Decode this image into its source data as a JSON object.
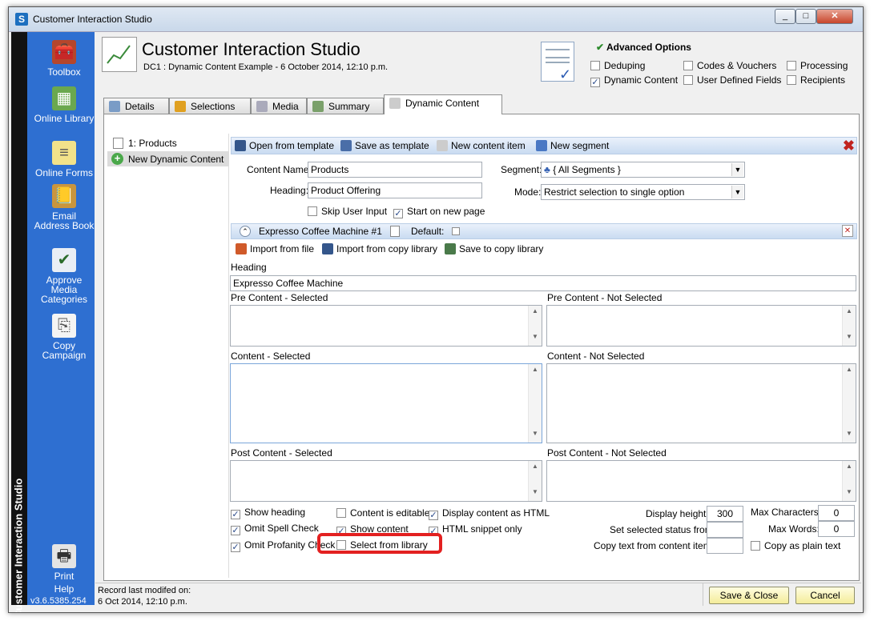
{
  "window": {
    "title": "Customer Interaction Studio",
    "app_icon": "S"
  },
  "sidebar": {
    "vertical_label": "Customer Interaction Studio",
    "items": [
      {
        "label": "Toolbox",
        "icon": "toolbox-icon"
      },
      {
        "label": "Online Library",
        "icon": "image-icon"
      },
      {
        "label": "Online Forms",
        "icon": "form-icon"
      },
      {
        "label": "Email Address Book",
        "icon": "address-book-icon"
      },
      {
        "label": "Approve Media Categories",
        "icon": "approve-media-icon"
      },
      {
        "label": "Copy Campaign",
        "icon": "copy-icon"
      }
    ],
    "print_label": "Print",
    "help_label": "Help",
    "version": "v3.6.5385.254"
  },
  "header": {
    "title": "Customer Interaction Studio",
    "subtitle": "DC1 : Dynamic Content Example - 6 October 2014, 12:10 p.m."
  },
  "advanced_options": {
    "title": "Advanced Options",
    "options": [
      {
        "label": "Deduping",
        "checked": false
      },
      {
        "label": "Codes & Vouchers",
        "checked": false
      },
      {
        "label": "Processing",
        "checked": false
      },
      {
        "label": "Dynamic Content",
        "checked": true
      },
      {
        "label": "User Defined Fields",
        "checked": false
      },
      {
        "label": "Recipients",
        "checked": false
      }
    ]
  },
  "tabs": [
    {
      "label": "Details"
    },
    {
      "label": "Selections"
    },
    {
      "label": "Media"
    },
    {
      "label": "Summary"
    },
    {
      "label": "Dynamic Content"
    }
  ],
  "tree": {
    "item1": "1: Products",
    "item2": "New Dynamic Content"
  },
  "toolbar": {
    "open_template": "Open from template",
    "save_template": "Save as template",
    "new_content_item": "New content item",
    "new_segment": "New segment"
  },
  "form": {
    "content_name_label": "Content Name:",
    "content_name_value": "Products",
    "heading_label": "Heading:",
    "heading_value": "Product Offering",
    "segment_label": "Segment:",
    "segment_value": "{ All Segments }",
    "mode_label": "Mode:",
    "mode_value": "Restrict selection to single option",
    "skip_user_input": "Skip User Input",
    "start_on_new_page": "Start on new page"
  },
  "item": {
    "title": "Expresso Coffee Machine #1",
    "default_label": "Default:",
    "import_file": "Import from file",
    "import_copy_library": "Import from copy library",
    "save_copy_library": "Save to copy library",
    "heading_label": "Heading",
    "heading_value": "Expresso Coffee Machine",
    "pre_selected": "Pre Content - Selected",
    "pre_not_selected": "Pre Content - Not Selected",
    "content_selected": "Content - Selected",
    "content_not_selected": "Content - Not Selected",
    "post_selected": "Post Content - Selected",
    "post_not_selected": "Post Content - Not Selected"
  },
  "options": {
    "show_heading": "Show heading",
    "omit_spell": "Omit Spell Check",
    "omit_profanity": "Omit Profanity Check",
    "content_editable": "Content is editable",
    "show_content": "Show content",
    "select_from_library": "Select from library",
    "display_html": "Display content as HTML",
    "html_snippet": "HTML snippet only",
    "display_height_label": "Display height:",
    "display_height_value": "300",
    "set_status_label": "Set selected status from",
    "copy_text_label": "Copy text from content item:",
    "max_chars_label": "Max Characters:",
    "max_chars_value": "0",
    "max_words_label": "Max Words:",
    "max_words_value": "0",
    "copy_plain": "Copy as plain text"
  },
  "footer": {
    "record_label": "Record last modifed on:",
    "record_value": "6 Oct 2014, 12:10 p.m.",
    "save_close": "Save & Close",
    "cancel": "Cancel"
  }
}
